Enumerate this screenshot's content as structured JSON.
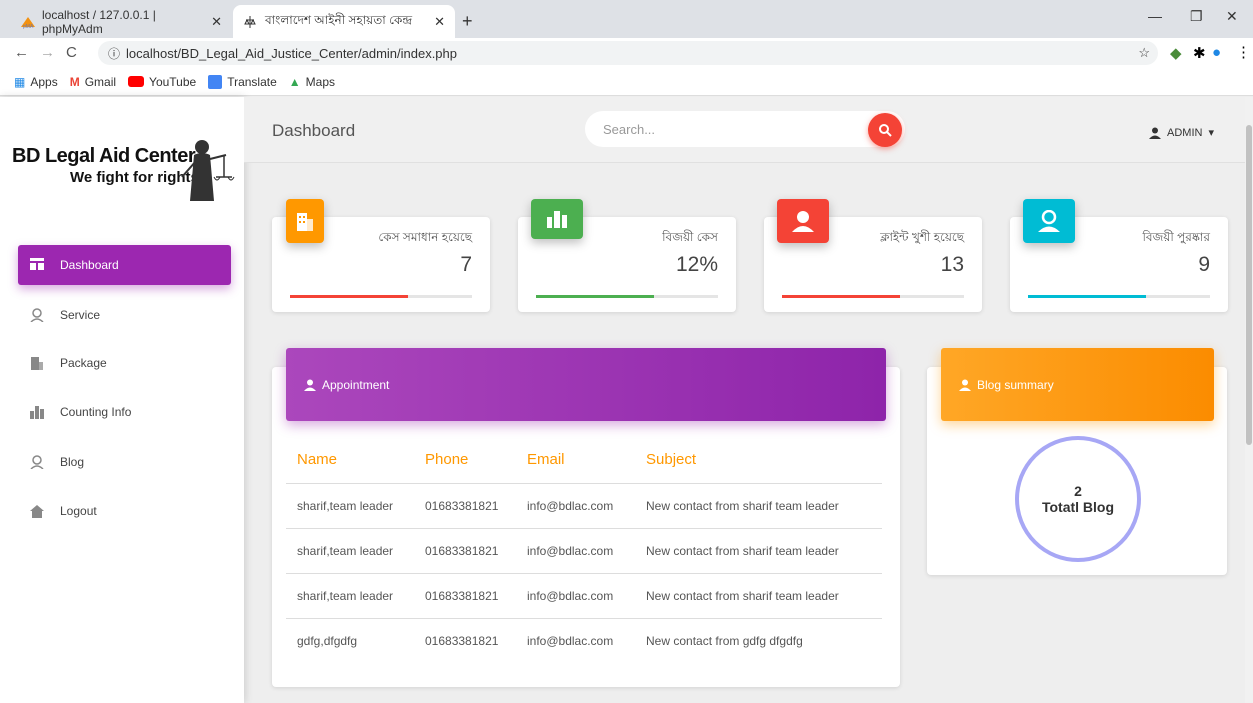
{
  "browser": {
    "tabs": [
      {
        "label": "localhost / 127.0.0.1 | phpMyAdm"
      },
      {
        "label": "বাংলাদেশ আইনী সহায়তা কেন্দ্র"
      }
    ],
    "url": "localhost/BD_Legal_Aid_Justice_Center/admin/index.php",
    "bookmarks": [
      "Apps",
      "Gmail",
      "YouTube",
      "Translate",
      "Maps"
    ]
  },
  "sidebar": {
    "logo_title": "BD Legal Aid Center",
    "logo_tagline": "We fight for rights",
    "items": [
      {
        "label": "Dashboard",
        "icon": "dashboard-icon"
      },
      {
        "label": "Service",
        "icon": "user-icon"
      },
      {
        "label": "Package",
        "icon": "building-icon"
      },
      {
        "label": "Counting Info",
        "icon": "city-icon"
      },
      {
        "label": "Blog",
        "icon": "user-icon"
      },
      {
        "label": "Logout",
        "icon": "home-icon"
      }
    ]
  },
  "header": {
    "title": "Dashboard",
    "search_placeholder": "Search...",
    "user": "ADMIN"
  },
  "stats": [
    {
      "label": "কেস সমাধান হয়েছে",
      "value": "7",
      "color": "#ff9800",
      "bar_color": "#f44336",
      "progress": 0.65
    },
    {
      "label": "বিজয়ী কেস",
      "value": "12%",
      "color": "#4caf50",
      "bar_color": "#4caf50",
      "progress": 0.65
    },
    {
      "label": "ক্লাইন্ট খুশী হয়েছে",
      "value": "13",
      "color": "#f44336",
      "bar_color": "#f44336",
      "progress": 0.65
    },
    {
      "label": "বিজয়ী পুরষ্কার",
      "value": "9",
      "color": "#00bcd4",
      "bar_color": "#00bcd4",
      "progress": 0.65
    }
  ],
  "appointment": {
    "title": "Appointment",
    "columns": [
      "Name",
      "Phone",
      "Email",
      "Subject"
    ],
    "rows": [
      [
        "sharif,team leader",
        "01683381821",
        "info@bdlac.com",
        "New contact from sharif team leader"
      ],
      [
        "sharif,team leader",
        "01683381821",
        "info@bdlac.com",
        "New contact from sharif team leader"
      ],
      [
        "sharif,team leader",
        "01683381821",
        "info@bdlac.com",
        "New contact from sharif team leader"
      ],
      [
        "gdfg,dfgdfg",
        "01683381821",
        "info@bdlac.com",
        "New contact from gdfg dfgdfg"
      ]
    ]
  },
  "blog": {
    "title": "Blog summary",
    "count": "2",
    "caption": "Totatl Blog"
  },
  "colors": {
    "accent": "#9c27b0",
    "blog": "#ff9800"
  }
}
